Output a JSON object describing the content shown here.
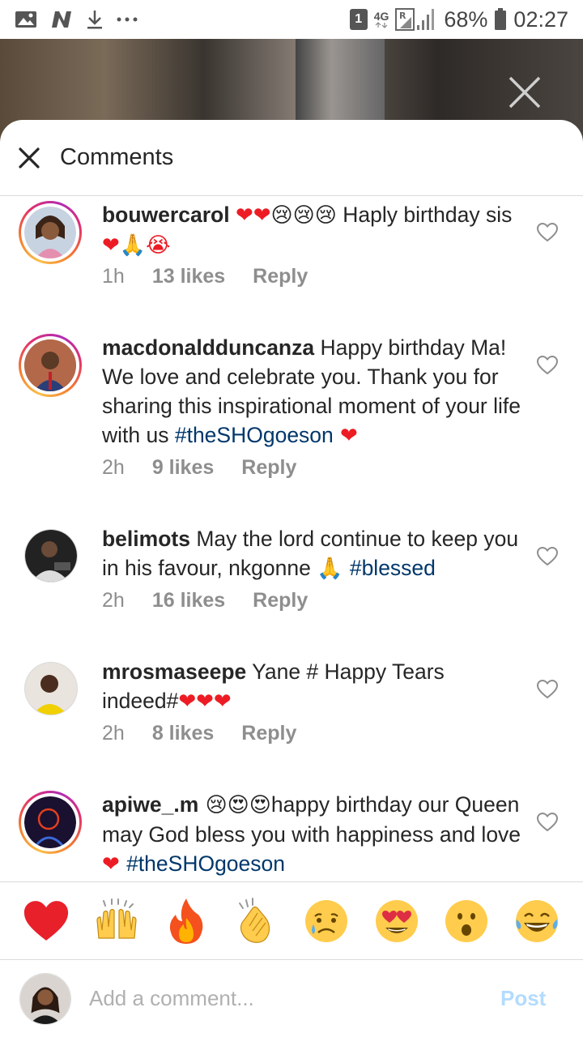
{
  "status_bar": {
    "sim_slot": "1",
    "network": "4G",
    "roaming": "R",
    "battery": "68%",
    "time": "02:27",
    "icons": [
      "image-icon",
      "n-notification-icon",
      "download-icon",
      "more-dots-icon"
    ]
  },
  "header": {
    "title": "Comments"
  },
  "comments": [
    {
      "username": "bouwercarol",
      "segments": [
        {
          "type": "emoji",
          "text": "❤❤"
        },
        {
          "type": "emoji",
          "text": "😢😢😢"
        },
        {
          "type": "text",
          "text": " Haply birthday sis"
        },
        {
          "type": "emoji",
          "text": "❤🙏😭"
        }
      ],
      "time": "1h",
      "likes": "13 likes",
      "reply": "Reply",
      "story_ring": true
    },
    {
      "username": "macdonaldduncanza",
      "segments": [
        {
          "type": "text",
          "text": " Happy birthday Ma! We love and celebrate you. Thank you for sharing this inspirational moment of your life with us "
        },
        {
          "type": "hashtag",
          "text": "#theSHOgoeson"
        },
        {
          "type": "emoji",
          "text": " ❤"
        }
      ],
      "time": "2h",
      "likes": "9 likes",
      "reply": "Reply",
      "story_ring": true
    },
    {
      "username": "belimots",
      "segments": [
        {
          "type": "text",
          "text": " May the lord continue to keep you in his favour, nkgonne "
        },
        {
          "type": "emoji",
          "text": "🙏 "
        },
        {
          "type": "hashtag",
          "text": "#blessed"
        }
      ],
      "time": "2h",
      "likes": "16 likes",
      "reply": "Reply",
      "story_ring": false
    },
    {
      "username": "mrosmaseepe",
      "segments": [
        {
          "type": "text",
          "text": " Yane  # Happy Tears indeed#"
        },
        {
          "type": "emoji",
          "text": "❤❤❤"
        }
      ],
      "time": "2h",
      "likes": "8 likes",
      "reply": "Reply",
      "story_ring": false
    },
    {
      "username": "apiwe_.m",
      "segments": [
        {
          "type": "emoji",
          "text": " 😢😍😍"
        },
        {
          "type": "text",
          "text": "happy birthday our Queen may God bless you with happiness and love"
        },
        {
          "type": "emoji",
          "text": "❤ "
        },
        {
          "type": "hashtag",
          "text": "#theSHOgoeson"
        }
      ],
      "time": "",
      "likes": "",
      "reply": "",
      "story_ring": true
    }
  ],
  "reactions": [
    {
      "name": "heart",
      "glyph": "❤"
    },
    {
      "name": "raised-hands",
      "glyph": "🙌"
    },
    {
      "name": "fire",
      "glyph": "🔥"
    },
    {
      "name": "clapping-hands",
      "glyph": "👏"
    },
    {
      "name": "crying-face",
      "glyph": "😢"
    },
    {
      "name": "heart-eyes",
      "glyph": "😍"
    },
    {
      "name": "surprised-face",
      "glyph": "😮"
    },
    {
      "name": "tears-of-joy",
      "glyph": "😂"
    }
  ],
  "input": {
    "placeholder": "Add a comment...",
    "post_label": "Post"
  },
  "colors": {
    "hashtag": "#00376b",
    "post_disabled": "#b3dbff",
    "heart_red": "#ed1c24"
  }
}
